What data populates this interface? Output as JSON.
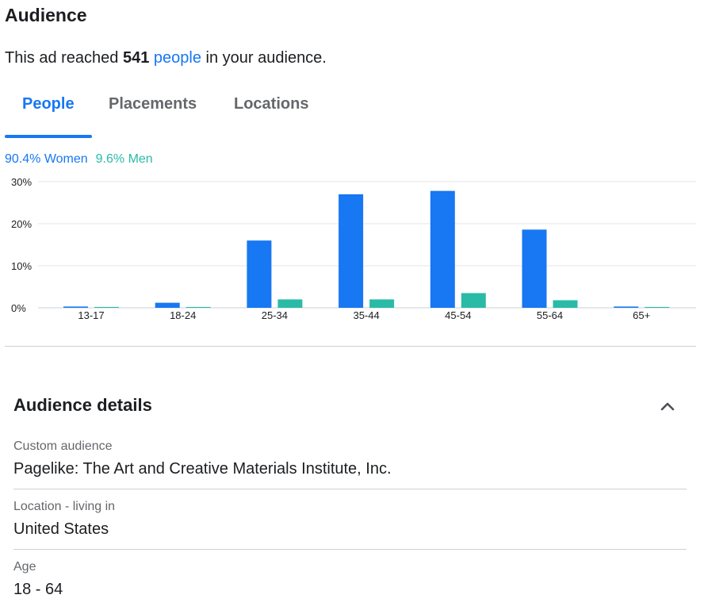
{
  "header": {
    "title": "Audience",
    "reach_prefix": "This ad reached ",
    "reach_count": "541",
    "reach_link": "people",
    "reach_suffix": " in your audience."
  },
  "tabs": [
    {
      "label": "People",
      "active": true
    },
    {
      "label": "Placements",
      "active": false
    },
    {
      "label": "Locations",
      "active": false
    }
  ],
  "gender": {
    "women_label": "90.4% Women",
    "men_label": "9.6% Men"
  },
  "colors": {
    "accent": "#1877f2",
    "women": "#1877f2",
    "men": "#2abba7",
    "grid": "#e4e6eb",
    "muted_text": "#65676b"
  },
  "chart_data": {
    "type": "bar",
    "categories": [
      "13-17",
      "18-24",
      "25-34",
      "35-44",
      "45-54",
      "55-64",
      "65+"
    ],
    "series": [
      {
        "name": "Women",
        "values": [
          0.3,
          1.2,
          16.0,
          27.0,
          27.8,
          18.6,
          0.3
        ]
      },
      {
        "name": "Men",
        "values": [
          0.2,
          0.2,
          2.0,
          2.0,
          3.5,
          1.8,
          0.2
        ]
      }
    ],
    "yticks": [
      "0%",
      "10%",
      "20%",
      "30%"
    ],
    "ylim": [
      0,
      30
    ],
    "grid": true
  },
  "details": {
    "title": "Audience details",
    "collapse_icon": "chevron-up-icon",
    "items": [
      {
        "label": "Custom audience",
        "value": "Pagelike: The Art and Creative Materials Institute, Inc."
      },
      {
        "label": "Location - living in",
        "value": "United States"
      },
      {
        "label": "Age",
        "value": "18 - 64"
      }
    ]
  }
}
